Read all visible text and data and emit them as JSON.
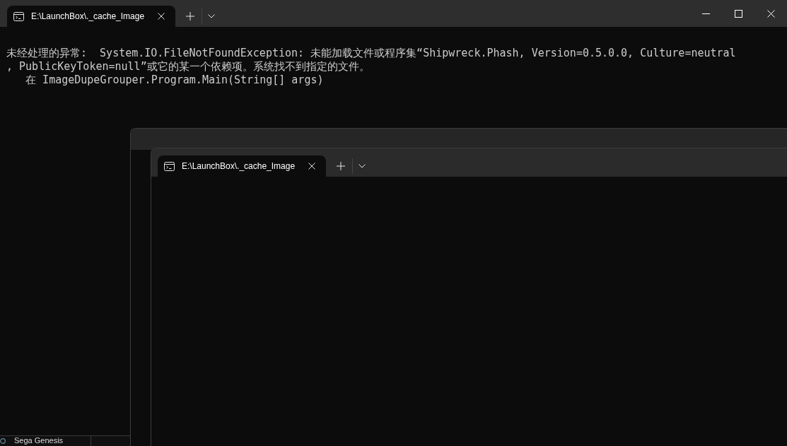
{
  "main_window": {
    "tabs": [
      {
        "title": "E:\\LaunchBox\\._cache_Image",
        "selected": true
      }
    ],
    "lines": [
      "未经处理的异常:  System.IO.FileNotFoundException: 未能加载文件或程序集“Shipwreck.Phash, Version=0.5.0.0, Culture=neutral",
      ", PublicKeyToken=null”或它的某一个依赖项。系统找不到指定的文件。",
      "   在 ImageDupeGrouper.Program.Main(String[] args)"
    ]
  },
  "overlapping_windows": [
    {
      "kind": "frame"
    },
    {
      "kind": "terminal",
      "tabs": [
        {
          "title": "E:\\LaunchBox\\._cache_Image",
          "selected": true
        }
      ]
    }
  ],
  "background_app": {
    "list_item": "Sega Genesis"
  }
}
